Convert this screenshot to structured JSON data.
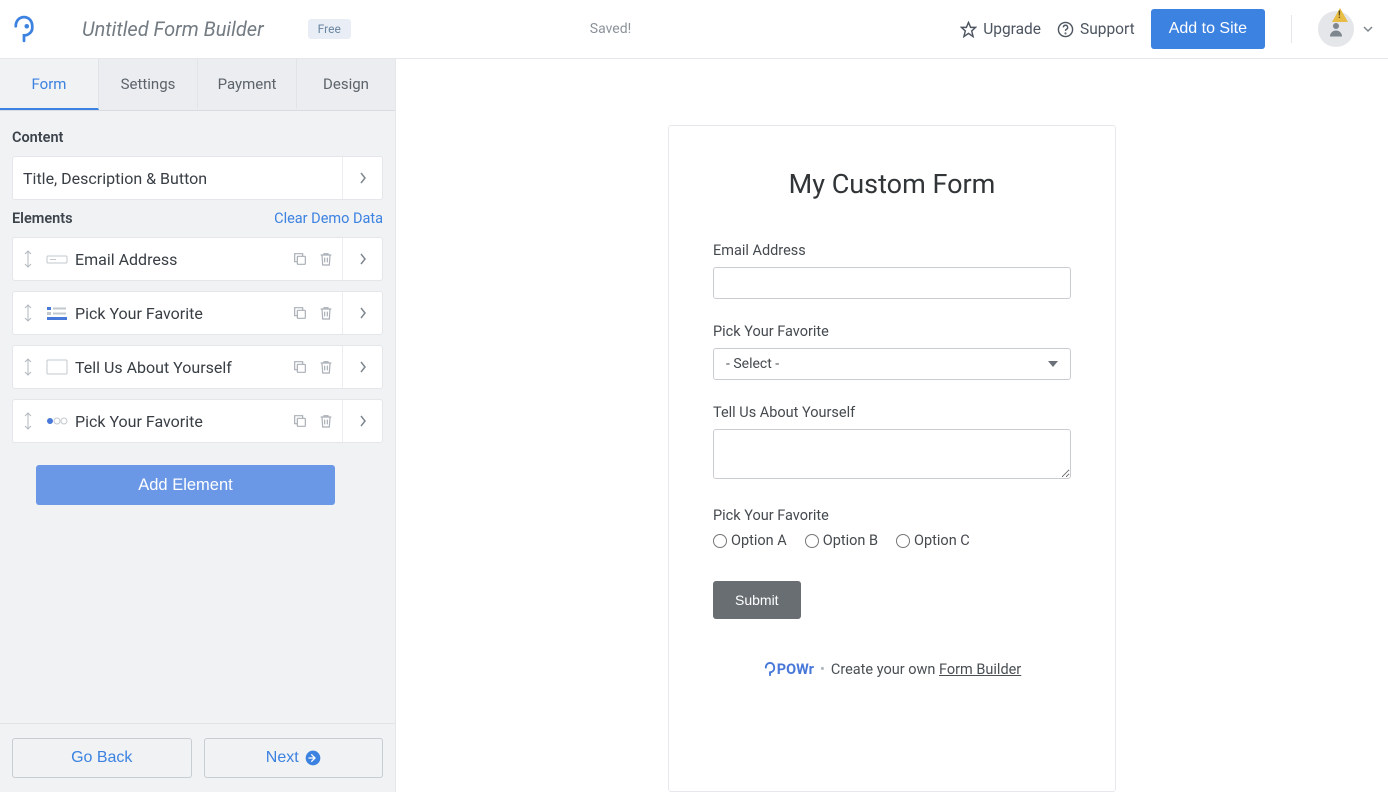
{
  "header": {
    "title": "Untitled Form Builder",
    "plan_badge": "Free",
    "saved_label": "Saved!",
    "upgrade_label": "Upgrade",
    "support_label": "Support",
    "add_to_site_label": "Add to Site"
  },
  "sidebar": {
    "tabs": [
      {
        "label": "Form"
      },
      {
        "label": "Settings"
      },
      {
        "label": "Payment"
      },
      {
        "label": "Design"
      }
    ],
    "content_label": "Content",
    "content_item": "Title, Description & Button",
    "elements_label": "Elements",
    "clear_demo_label": "Clear Demo Data",
    "elements": [
      {
        "label": "Email Address",
        "type": "text"
      },
      {
        "label": "Pick Your Favorite",
        "type": "select"
      },
      {
        "label": "Tell Us About Yourself",
        "type": "textarea"
      },
      {
        "label": "Pick Your Favorite",
        "type": "radio"
      }
    ],
    "add_element_label": "Add Element",
    "go_back_label": "Go Back",
    "next_label": "Next"
  },
  "preview": {
    "form_title": "My Custom Form",
    "fields": {
      "email_label": "Email Address",
      "select_label": "Pick Your Favorite",
      "select_placeholder": "- Select -",
      "textarea_label": "Tell Us About Yourself",
      "radio_label": "Pick Your Favorite",
      "radio_options": [
        "Option A",
        "Option B",
        "Option C"
      ]
    },
    "submit_label": "Submit",
    "footer": {
      "brand": "POWr",
      "create_text": "Create your own ",
      "link_text": "Form Builder"
    }
  }
}
